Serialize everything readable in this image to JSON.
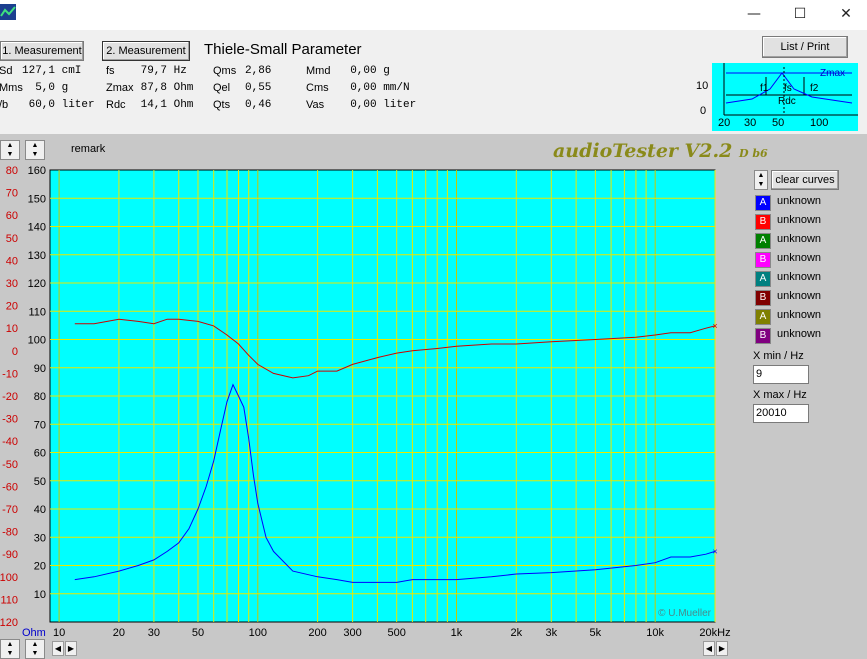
{
  "window": {
    "minimize": "—",
    "maximize": "☐",
    "close": "✕"
  },
  "tabs": {
    "measurement1": "1. Measurement",
    "measurement2": "2. Measurement"
  },
  "section_title": "Thiele-Small Parameter",
  "list_print": "List / Print",
  "ts_params": {
    "col1": [
      {
        "label": "Sd",
        "value": "127,1 cmI"
      },
      {
        "label": "Mms",
        "value": "  5,0 g"
      },
      {
        "label": "/b",
        "value": " 60,0 liter"
      }
    ],
    "col2": [
      {
        "label": "fs",
        "value": " 79,7 Hz"
      },
      {
        "label": "Zmax",
        "value": " 87,8 Ohm"
      },
      {
        "label": "Rdc",
        "value": " 14,1 Ohm"
      }
    ],
    "col3": [
      {
        "label": "Qms",
        "value": "2,86"
      },
      {
        "label": "Qel",
        "value": "0,55"
      },
      {
        "label": "Qts",
        "value": "0,46"
      }
    ],
    "col4": [
      {
        "label": "Mmd",
        "value": "  0,00 g"
      },
      {
        "label": "Cms",
        "value": "  0,00 mm/N"
      },
      {
        "label": "Vas",
        "value": "  0,00 liter"
      }
    ]
  },
  "mini_graph": {
    "y_tick_top": "10",
    "y_tick_bottom": "0",
    "x_ticks": [
      "20",
      "30",
      "50",
      "100"
    ],
    "labels": {
      "zmax": "Zmax",
      "f1": "f1",
      "fs": "fs",
      "f2": "f2",
      "rdc": "Rdc"
    }
  },
  "remark": "remark",
  "brand": {
    "name": "audioTester V2.2",
    "build": "D b6"
  },
  "copyright": "© U.Mueller",
  "clear_curves": "clear curves",
  "legend": [
    {
      "letter": "A",
      "text": "unknown",
      "color": "#0000ff"
    },
    {
      "letter": "B",
      "text": "unknown",
      "color": "#ff0000"
    },
    {
      "letter": "A",
      "text": "unknown",
      "color": "#008000"
    },
    {
      "letter": "B",
      "text": "unknown",
      "color": "#ff00ff"
    },
    {
      "letter": "A",
      "text": "unknown",
      "color": "#008080"
    },
    {
      "letter": "B",
      "text": "unknown",
      "color": "#800000"
    },
    {
      "letter": "A",
      "text": "unknown",
      "color": "#808000"
    },
    {
      "letter": "B",
      "text": "unknown",
      "color": "#800080"
    }
  ],
  "xmin_label": "X min / Hz",
  "xmin_value": "9",
  "xmax_label": "X max / Hz",
  "xmax_value": "20010",
  "chart_data": {
    "type": "line",
    "x_scale": "log",
    "xlim": [
      9,
      20000
    ],
    "x_ticks": [
      {
        "v": 10,
        "label": "10"
      },
      {
        "v": 20,
        "label": "20"
      },
      {
        "v": 30,
        "label": "30"
      },
      {
        "v": 50,
        "label": "50"
      },
      {
        "v": 100,
        "label": "100"
      },
      {
        "v": 200,
        "label": "200"
      },
      {
        "v": 300,
        "label": "300"
      },
      {
        "v": 500,
        "label": "500"
      },
      {
        "v": 1000,
        "label": "1k"
      },
      {
        "v": 2000,
        "label": "2k"
      },
      {
        "v": 3000,
        "label": "3k"
      },
      {
        "v": 5000,
        "label": "5k"
      },
      {
        "v": 10000,
        "label": "10k"
      },
      {
        "v": 20000,
        "label": "20kHz"
      }
    ],
    "x_unit_left": "Ohm",
    "y_right_axis": {
      "label_ticks": [
        "160",
        "150",
        "140",
        "130",
        "120",
        "110",
        "100",
        "90",
        "80",
        "70",
        "60",
        "50",
        "40",
        "30",
        "20",
        "10"
      ],
      "ylim": [
        0,
        160
      ]
    },
    "y_left_axis": {
      "label_ticks": [
        "80",
        "70",
        "60",
        "50",
        "40",
        "30",
        "20",
        "10",
        "0",
        "-10",
        "-20",
        "-30",
        "-40",
        "-50",
        "-60",
        "-70",
        "-80",
        "-90",
        "-100",
        "-110",
        "-120"
      ],
      "ylim": [
        -120,
        80
      ],
      "color": "#cc0000"
    },
    "series": [
      {
        "name": "A",
        "color": "#0000ff",
        "axis": "impedance",
        "points": [
          [
            12,
            15
          ],
          [
            15,
            16
          ],
          [
            20,
            18
          ],
          [
            25,
            20
          ],
          [
            30,
            22
          ],
          [
            35,
            25
          ],
          [
            40,
            28
          ],
          [
            45,
            33
          ],
          [
            50,
            40
          ],
          [
            55,
            48
          ],
          [
            60,
            57
          ],
          [
            65,
            68
          ],
          [
            70,
            78
          ],
          [
            75,
            84
          ],
          [
            80,
            80
          ],
          [
            85,
            76
          ],
          [
            90,
            65
          ],
          [
            95,
            52
          ],
          [
            100,
            42
          ],
          [
            110,
            30
          ],
          [
            120,
            25
          ],
          [
            150,
            18
          ],
          [
            200,
            16
          ],
          [
            250,
            15
          ],
          [
            300,
            14
          ],
          [
            400,
            14
          ],
          [
            500,
            14
          ],
          [
            600,
            15
          ],
          [
            800,
            15
          ],
          [
            1000,
            15
          ],
          [
            1500,
            16
          ],
          [
            2000,
            17
          ],
          [
            3000,
            17.5
          ],
          [
            5000,
            18.5
          ],
          [
            8000,
            20
          ],
          [
            10000,
            21
          ],
          [
            12000,
            23
          ],
          [
            15000,
            23
          ],
          [
            18000,
            24
          ],
          [
            20000,
            25
          ]
        ]
      },
      {
        "name": "B",
        "color": "#cc0000",
        "axis": "phase",
        "points": [
          [
            12,
            12
          ],
          [
            15,
            12
          ],
          [
            20,
            14
          ],
          [
            25,
            13
          ],
          [
            30,
            12
          ],
          [
            35,
            14
          ],
          [
            40,
            14
          ],
          [
            50,
            13
          ],
          [
            60,
            11
          ],
          [
            70,
            7
          ],
          [
            80,
            3
          ],
          [
            90,
            -2
          ],
          [
            100,
            -6
          ],
          [
            120,
            -10
          ],
          [
            150,
            -12
          ],
          [
            180,
            -11
          ],
          [
            200,
            -9
          ],
          [
            250,
            -9
          ],
          [
            300,
            -6
          ],
          [
            400,
            -3
          ],
          [
            500,
            -1
          ],
          [
            600,
            0
          ],
          [
            800,
            1
          ],
          [
            1000,
            2
          ],
          [
            1500,
            3
          ],
          [
            2000,
            3
          ],
          [
            3000,
            4
          ],
          [
            5000,
            5
          ],
          [
            8000,
            6
          ],
          [
            10000,
            7
          ],
          [
            12000,
            8
          ],
          [
            15000,
            8
          ],
          [
            18000,
            10
          ],
          [
            20000,
            11
          ]
        ]
      }
    ]
  }
}
